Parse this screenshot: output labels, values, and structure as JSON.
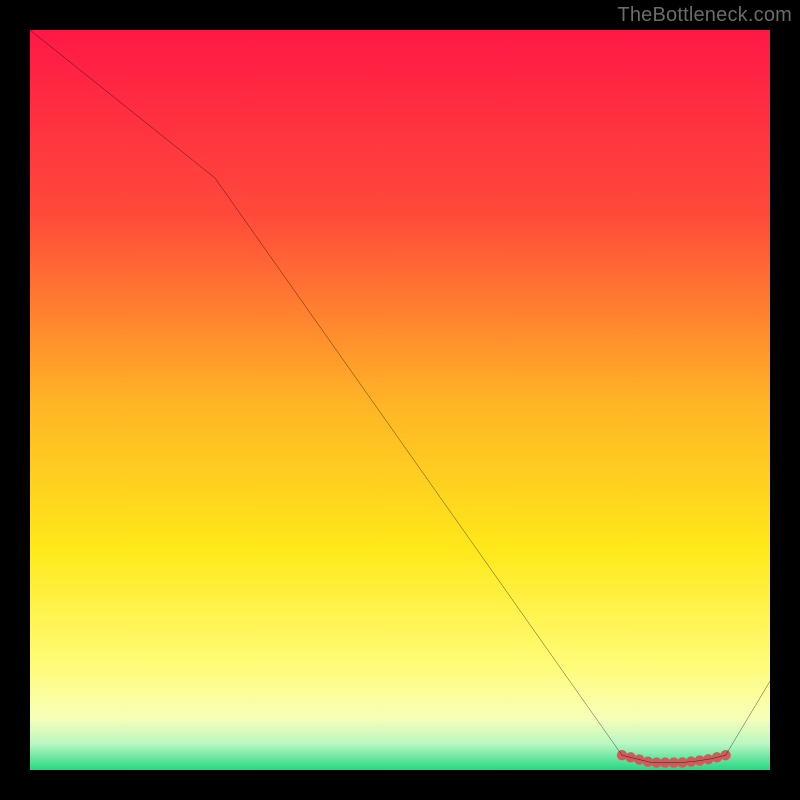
{
  "attribution": "TheBottleneck.com",
  "chart_data": {
    "type": "line",
    "title": "",
    "xlabel": "",
    "ylabel": "",
    "xlim": [
      0,
      100
    ],
    "ylim": [
      0,
      100
    ],
    "x": [
      0,
      25,
      80,
      82,
      84,
      86,
      88,
      90,
      92,
      94,
      100
    ],
    "values": [
      100,
      80,
      2,
      1.5,
      1,
      1,
      1,
      1.2,
      1.5,
      2,
      12
    ],
    "optimal_region": {
      "x_start": 80,
      "x_end": 94,
      "marker_color": "#d15a5a"
    },
    "background": {
      "stops": [
        {
          "pos": 0.0,
          "color": "#ff1846"
        },
        {
          "pos": 0.25,
          "color": "#ff4a3a"
        },
        {
          "pos": 0.5,
          "color": "#ffb326"
        },
        {
          "pos": 0.7,
          "color": "#ffe81a"
        },
        {
          "pos": 0.86,
          "color": "#fffc7a"
        },
        {
          "pos": 0.93,
          "color": "#f7ffb8"
        },
        {
          "pos": 0.965,
          "color": "#b8f7c2"
        },
        {
          "pos": 1.0,
          "color": "#25d884"
        }
      ]
    }
  }
}
